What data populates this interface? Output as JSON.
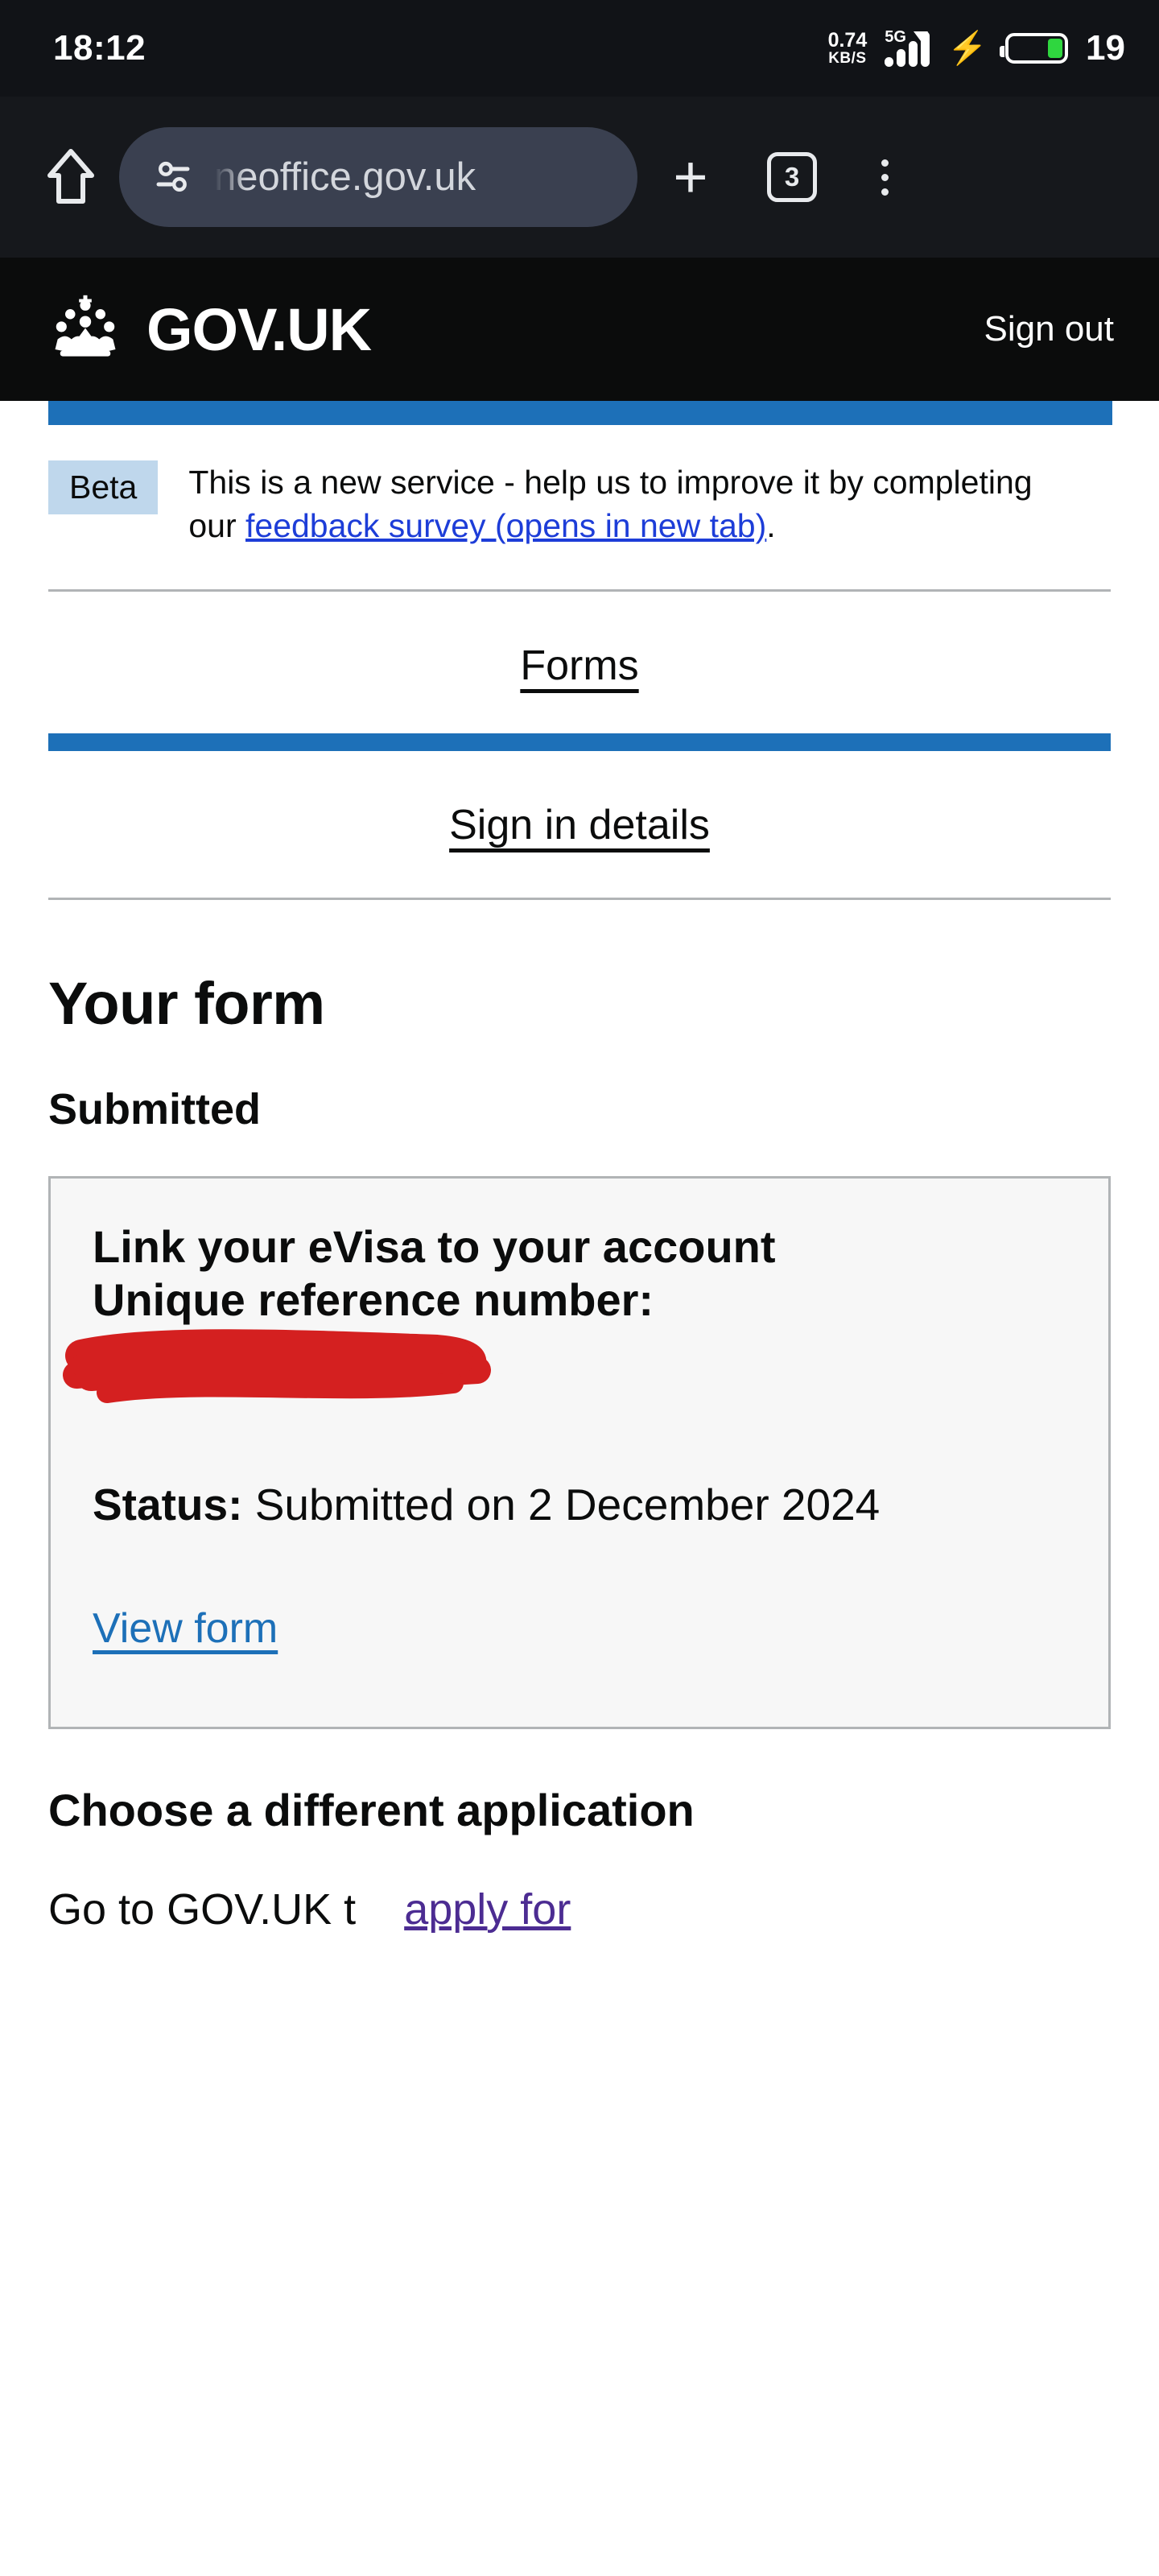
{
  "status_bar": {
    "time": "18:12",
    "net_speed_value": "0.74",
    "net_speed_unit": "KB/S",
    "network_type": "5G",
    "charging_icon": "lightning-bolt-icon",
    "battery_percent": "19"
  },
  "browser": {
    "home_icon": "home-icon",
    "site_settings_icon": "tune-sliders-icon",
    "url": "neoffice.gov.uk",
    "new_tab_label": "+",
    "tab_count": "3",
    "menu_icon": "three-dot-menu-icon"
  },
  "site_header": {
    "crown_icon": "gov-uk-crown-icon",
    "wordmark": "GOV.UK",
    "sign_out_label": "Sign out"
  },
  "phase_banner": {
    "tag": "Beta",
    "text_before": "This is a new service - help us to improve it by completing our ",
    "link": "feedback survey (opens in new tab)",
    "text_after": "."
  },
  "nav": {
    "items": [
      {
        "label": "Forms",
        "active": true
      },
      {
        "label": "Sign in details",
        "active": false
      }
    ]
  },
  "main": {
    "page_title": "Your form",
    "section_title": "Submitted",
    "card": {
      "title": "Link your eVisa to your account",
      "reference_label": "Unique reference number:",
      "reference_value_redacted": true,
      "status_label": "Status:",
      "status_value": "Submitted on 2 December 2024",
      "view_form_label": "View form"
    },
    "choose_heading": "Choose a different application",
    "tail_text_before": "Go to GOV.UK t",
    "tail_link": "apply for"
  },
  "colors": {
    "govuk_blue": "#1d70b8",
    "govuk_black": "#0b0c0c",
    "link_blue": "#1d3dd8",
    "visited_purple": "#4c2c92",
    "beta_tag_bg": "#bfd7ec",
    "card_bg": "#f7f7f7",
    "card_border": "#b1b4b6",
    "redaction_red": "#d42020",
    "battery_green": "#2fd63f"
  }
}
